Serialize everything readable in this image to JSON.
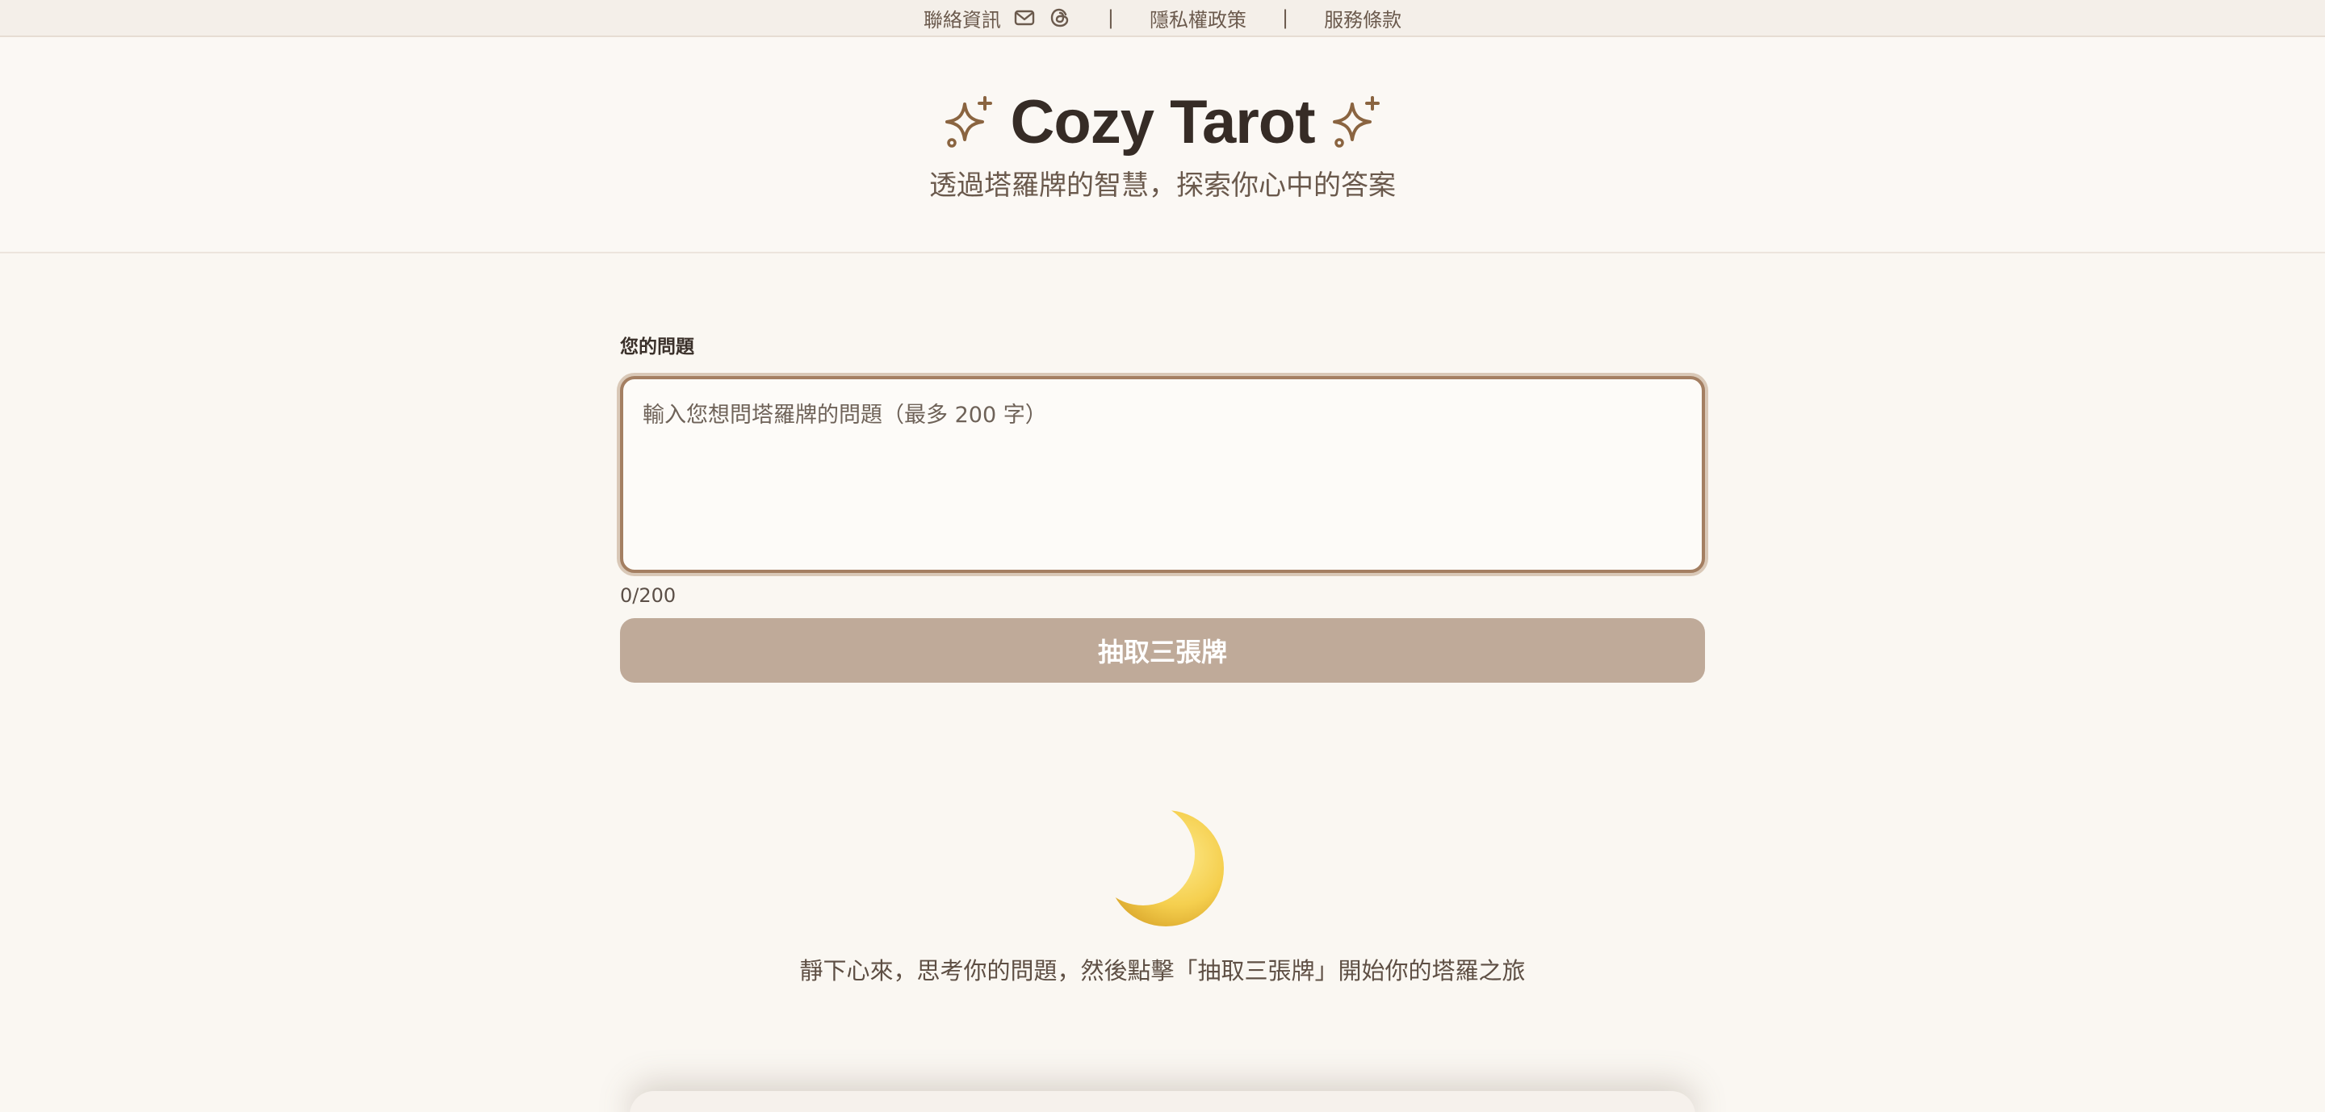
{
  "topbar": {
    "contact": "聯絡資訊",
    "separator": "|",
    "privacy": "隱私權政策",
    "terms": "服務條款",
    "icons": [
      "mail-icon",
      "threads-icon"
    ]
  },
  "header": {
    "title": "Cozy Tarot",
    "subtitle": "透過塔羅牌的智慧，探索你心中的答案",
    "sparkle_color": "#8a6440"
  },
  "form": {
    "label": "您的問題",
    "placeholder": "輸入您想問塔羅牌的問題（最多 200 字）",
    "value": "",
    "counter": "0/200",
    "button": "抽取三張牌"
  },
  "empty_state": {
    "icon": "crescent-moon-icon",
    "hint": "靜下心來，思考你的問題，然後點擊「抽取三張牌」開始你的塔羅之旅"
  },
  "colors": {
    "background": "#faf7f2",
    "accent": "#a47f62",
    "button_disabled": "#bfaa99"
  }
}
